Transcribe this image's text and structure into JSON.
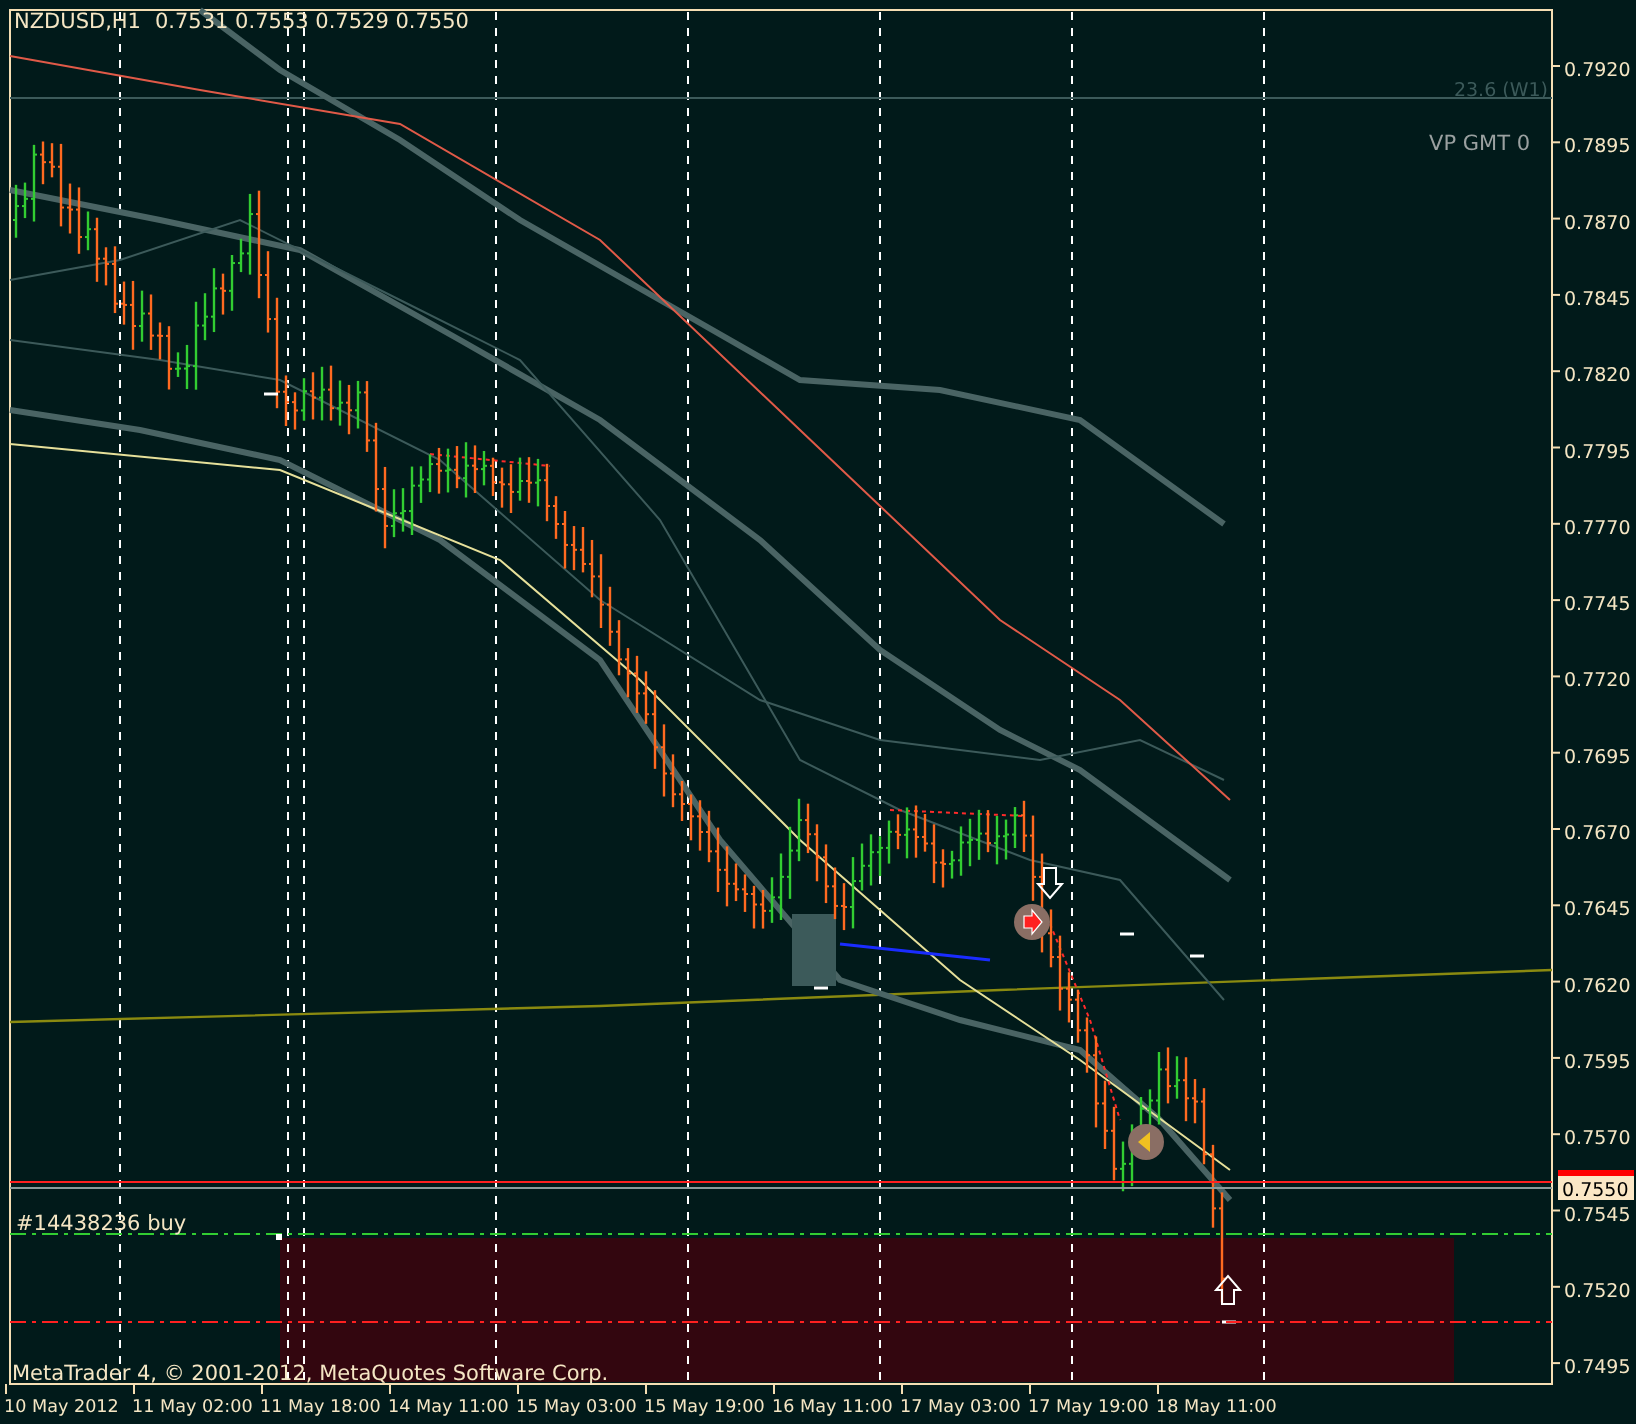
{
  "chart_header": {
    "symbol": "NZDUSD,H1",
    "quotes": [
      "0.7531",
      "0.7553",
      "0.7529",
      "0.7550"
    ]
  },
  "chart_labels": {
    "fibo_level": "23.6 (W1)",
    "indicator_name": "VP GMT 0",
    "order": "#14438236 buy",
    "copyright": "MetaTrader 4, © 2001-2012, MetaQuotes Software Corp."
  },
  "price_axis": [
    "0.7920",
    "0.7895",
    "0.7870",
    "0.7845",
    "0.7820",
    "0.7795",
    "0.7770",
    "0.7745",
    "0.7720",
    "0.7695",
    "0.7670",
    "0.7645",
    "0.7620",
    "0.7595",
    "0.7570",
    "0.7545",
    "0.7520",
    "0.7495"
  ],
  "current_price": "0.7550",
  "time_axis": [
    "10 May 2012",
    "11 May 02:00",
    "11 May 18:00",
    "14 May 11:00",
    "15 May 03:00",
    "15 May 19:00",
    "16 May 11:00",
    "17 May 03:00",
    "17 May 19:00",
    "18 May 11:00"
  ]
}
